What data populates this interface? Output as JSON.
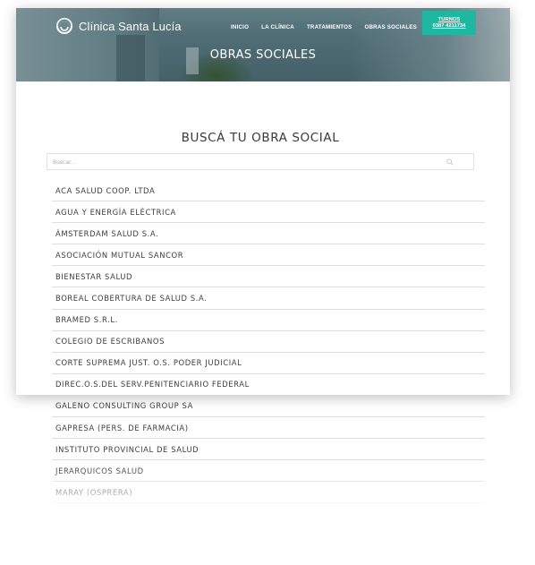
{
  "header": {
    "logo_text": "Clínica Santa Lucía",
    "nav": [
      {
        "label": "INICIO"
      },
      {
        "label": "LA CLÍNICA"
      },
      {
        "label": "TRATAMIENTOS"
      },
      {
        "label": "OBRAS SOCIALES"
      }
    ],
    "turnos": {
      "label": "TURNOS",
      "phone": "0387 4211734"
    },
    "accent_color": "#1fb79f"
  },
  "hero": {
    "title": "OBRAS SOCIALES"
  },
  "main": {
    "title": "BUSCÁ TU OBRA SOCIAL",
    "search": {
      "placeholder": "Buscar...",
      "icon": "search-icon"
    },
    "items": [
      {
        "label": "ACA SALUD COOP. LTDA"
      },
      {
        "label": "AGUA Y ENERGÍA ELÉCTRICA"
      },
      {
        "label": "ÁMSTERDAM SALUD S.A."
      },
      {
        "label": "ASOCIACIÓN MUTUAL SANCOR"
      },
      {
        "label": "BIENESTAR SALUD"
      },
      {
        "label": "BOREAL COBERTURA DE SALUD S.A."
      },
      {
        "label": "BRAMED S.R.L."
      },
      {
        "label": "COLEGIO DE ESCRIBANOS"
      },
      {
        "label": "CORTE SUPREMA JUST. O.S. PODER JUDICIAL"
      },
      {
        "label": "DIREC.O.S.DEL SERV.PENITENCIARIO FEDERAL"
      },
      {
        "label": "GALENO CONSULTING GROUP SA"
      },
      {
        "label": "GAPRESA (PERS. DE FARMACIA)"
      },
      {
        "label": "INSTITUTO PROVINCIAL DE SALUD"
      },
      {
        "label": "JERARQUICOS SALUD"
      },
      {
        "label": "MARAY (OSPRERA)"
      }
    ]
  }
}
